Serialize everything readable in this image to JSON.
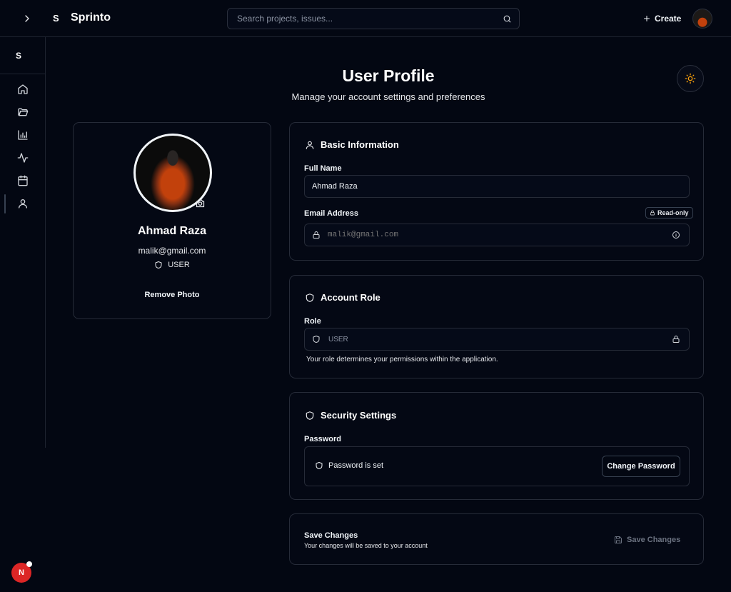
{
  "topbar": {
    "logo_letter": "S",
    "brand": "Sprinto",
    "search_placeholder": "Search projects, issues...",
    "create_label": "Create"
  },
  "sidebar": {
    "logo_letter": "S",
    "items": [
      {
        "name": "home-icon"
      },
      {
        "name": "folder-icon"
      },
      {
        "name": "bar-chart-icon"
      },
      {
        "name": "activity-icon"
      },
      {
        "name": "calendar-icon"
      },
      {
        "name": "user-icon"
      }
    ]
  },
  "header": {
    "title": "User Profile",
    "subtitle": "Manage your account settings and preferences"
  },
  "profile": {
    "name": "Ahmad Raza",
    "email": "malik@gmail.com",
    "role": "USER",
    "remove_photo_label": "Remove Photo"
  },
  "basic_info": {
    "title": "Basic Information",
    "full_name_label": "Full Name",
    "full_name_value": "Ahmad Raza",
    "email_label": "Email Address",
    "readonly_badge": "Read-only",
    "email_placeholder": "malik@gmail.com"
  },
  "account_role": {
    "title": "Account Role",
    "role_label": "Role",
    "role_value": "USER",
    "hint": "Your role determines your permissions within the application."
  },
  "security": {
    "title": "Security Settings",
    "password_label": "Password",
    "password_status": "Password is set",
    "change_password_label": "Change Password"
  },
  "save": {
    "title": "Save Changes",
    "subtitle": "Your changes will be saved to your account",
    "button_label": "Save Changes"
  },
  "badge": {
    "letter": "N"
  },
  "colors": {
    "background": "#030712",
    "accent_sun": "#f59e0b",
    "badge_red": "#dc2626"
  }
}
